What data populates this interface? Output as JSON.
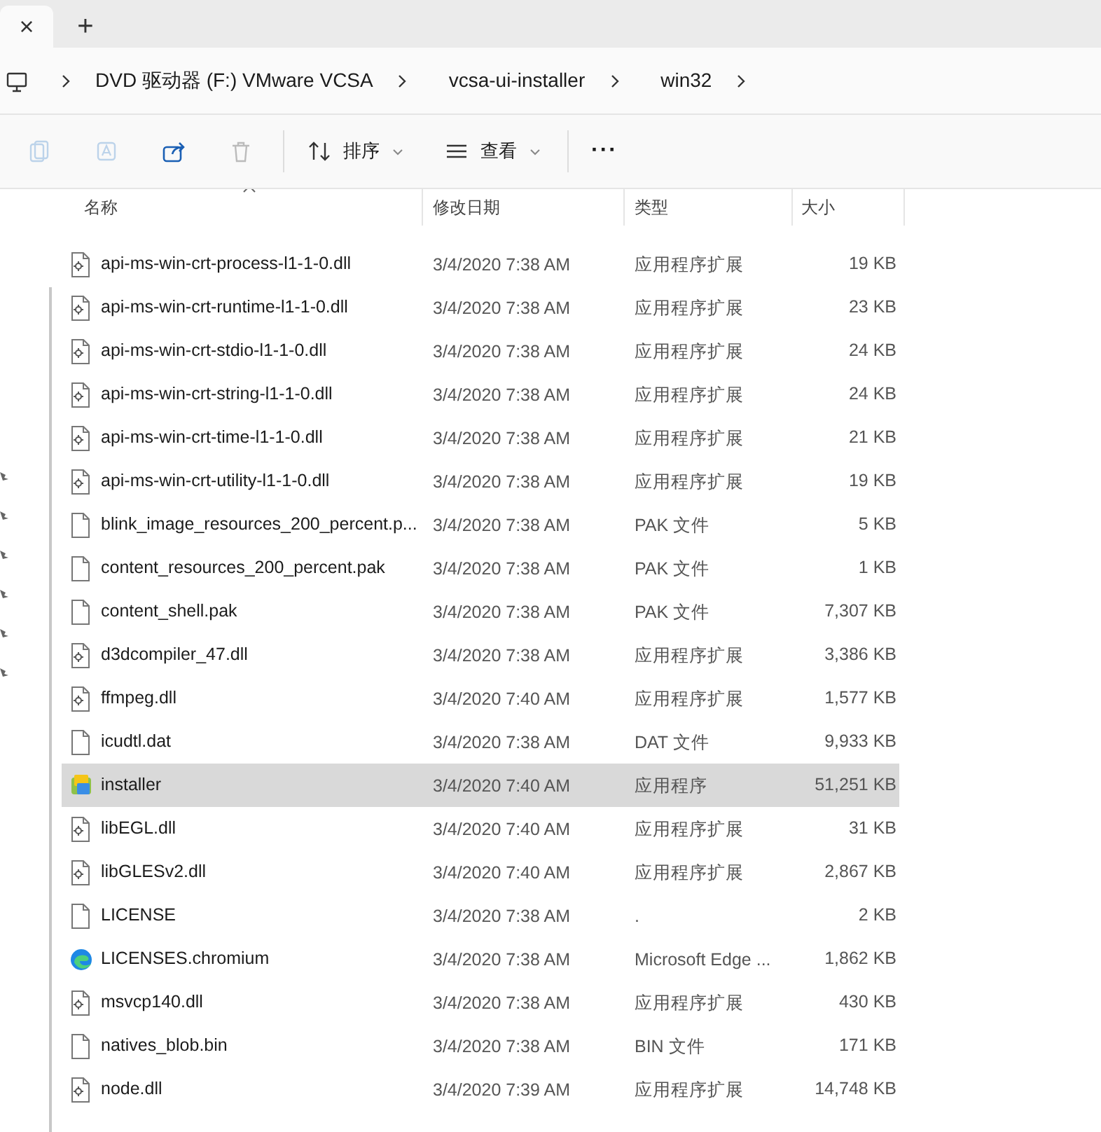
{
  "tabs": [
    {
      "label": "×",
      "selected": true
    },
    {
      "label": "+",
      "selected": false
    }
  ],
  "breadcrumb": [
    "DVD 驱动器 (F:) VMware VCSA",
    "vcsa-ui-installer",
    "win32"
  ],
  "toolbar": {
    "sort": "排序",
    "view": "查看",
    "more": "···"
  },
  "columns": [
    "名称",
    "修改日期",
    "类型",
    "大小"
  ],
  "rows": [
    {
      "kind": "dll",
      "name": "api-ms-win-crt-process-l1-1-0.dll",
      "date": "3/4/2020 7:38 AM",
      "type": "应用程序扩展",
      "size": "19 KB",
      "selected": false
    },
    {
      "kind": "dll",
      "name": "api-ms-win-crt-runtime-l1-1-0.dll",
      "date": "3/4/2020 7:38 AM",
      "type": "应用程序扩展",
      "size": "23 KB",
      "selected": false
    },
    {
      "kind": "dll",
      "name": "api-ms-win-crt-stdio-l1-1-0.dll",
      "date": "3/4/2020 7:38 AM",
      "type": "应用程序扩展",
      "size": "24 KB",
      "selected": false
    },
    {
      "kind": "dll",
      "name": "api-ms-win-crt-string-l1-1-0.dll",
      "date": "3/4/2020 7:38 AM",
      "type": "应用程序扩展",
      "size": "24 KB",
      "selected": false
    },
    {
      "kind": "dll",
      "name": "api-ms-win-crt-time-l1-1-0.dll",
      "date": "3/4/2020 7:38 AM",
      "type": "应用程序扩展",
      "size": "21 KB",
      "selected": false
    },
    {
      "kind": "dll",
      "name": "api-ms-win-crt-utility-l1-1-0.dll",
      "date": "3/4/2020 7:38 AM",
      "type": "应用程序扩展",
      "size": "19 KB",
      "selected": false
    },
    {
      "kind": "file",
      "name": "blink_image_resources_200_percent.p...",
      "date": "3/4/2020 7:38 AM",
      "type": "PAK 文件",
      "size": "5 KB",
      "selected": false
    },
    {
      "kind": "file",
      "name": "content_resources_200_percent.pak",
      "date": "3/4/2020 7:38 AM",
      "type": "PAK 文件",
      "size": "1 KB",
      "selected": false
    },
    {
      "kind": "file",
      "name": "content_shell.pak",
      "date": "3/4/2020 7:38 AM",
      "type": "PAK 文件",
      "size": "7,307 KB",
      "selected": false
    },
    {
      "kind": "dll",
      "name": "d3dcompiler_47.dll",
      "date": "3/4/2020 7:38 AM",
      "type": "应用程序扩展",
      "size": "3,386 KB",
      "selected": false
    },
    {
      "kind": "dll",
      "name": "ffmpeg.dll",
      "date": "3/4/2020 7:40 AM",
      "type": "应用程序扩展",
      "size": "1,577 KB",
      "selected": false
    },
    {
      "kind": "file",
      "name": "icudtl.dat",
      "date": "3/4/2020 7:38 AM",
      "type": "DAT 文件",
      "size": "9,933 KB",
      "selected": false
    },
    {
      "kind": "app",
      "name": "installer",
      "date": "3/4/2020 7:40 AM",
      "type": "应用程序",
      "size": "51,251 KB",
      "selected": true
    },
    {
      "kind": "dll",
      "name": "libEGL.dll",
      "date": "3/4/2020 7:40 AM",
      "type": "应用程序扩展",
      "size": "31 KB",
      "selected": false
    },
    {
      "kind": "dll",
      "name": "libGLESv2.dll",
      "date": "3/4/2020 7:40 AM",
      "type": "应用程序扩展",
      "size": "2,867 KB",
      "selected": false
    },
    {
      "kind": "file",
      "name": "LICENSE",
      "date": "3/4/2020 7:38 AM",
      "type": ".",
      "size": "2 KB",
      "selected": false
    },
    {
      "kind": "edge",
      "name": "LICENSES.chromium",
      "date": "3/4/2020 7:38 AM",
      "type": "Microsoft Edge ...",
      "size": "1,862 KB",
      "selected": false
    },
    {
      "kind": "dll",
      "name": "msvcp140.dll",
      "date": "3/4/2020 7:38 AM",
      "type": "应用程序扩展",
      "size": "430 KB",
      "selected": false
    },
    {
      "kind": "file",
      "name": "natives_blob.bin",
      "date": "3/4/2020 7:38 AM",
      "type": "BIN 文件",
      "size": "171 KB",
      "selected": false
    },
    {
      "kind": "dll",
      "name": "node.dll",
      "date": "3/4/2020 7:39 AM",
      "type": "应用程序扩展",
      "size": "14,748 KB",
      "selected": false
    }
  ]
}
